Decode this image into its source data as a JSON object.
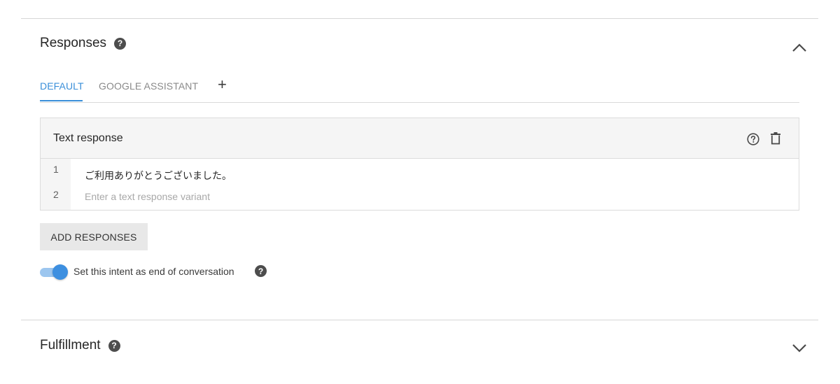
{
  "responses": {
    "title": "Responses",
    "tabs": [
      {
        "label": "DEFAULT",
        "active": true
      },
      {
        "label": "GOOGLE ASSISTANT",
        "active": false
      }
    ],
    "add_tab_label": "+",
    "text_response": {
      "title": "Text response",
      "rows": [
        {
          "number": "1",
          "text": "ご利用ありがとうございました。"
        },
        {
          "number": "2",
          "value": "",
          "placeholder": "Enter a text response variant"
        }
      ]
    },
    "add_responses_label": "ADD RESPONSES",
    "end_conversation": {
      "label": "Set this intent as end of conversation",
      "enabled": true
    }
  },
  "fulfillment": {
    "title": "Fulfillment"
  },
  "icons": {
    "help": "help-circle-icon",
    "trash": "trash-icon",
    "collapse": "chevron-up-icon",
    "expand": "chevron-down-icon"
  },
  "colors": {
    "accent": "#3a8fd9",
    "toggle_on": "#3d8fe0",
    "toggle_track": "#9cc6ef"
  }
}
